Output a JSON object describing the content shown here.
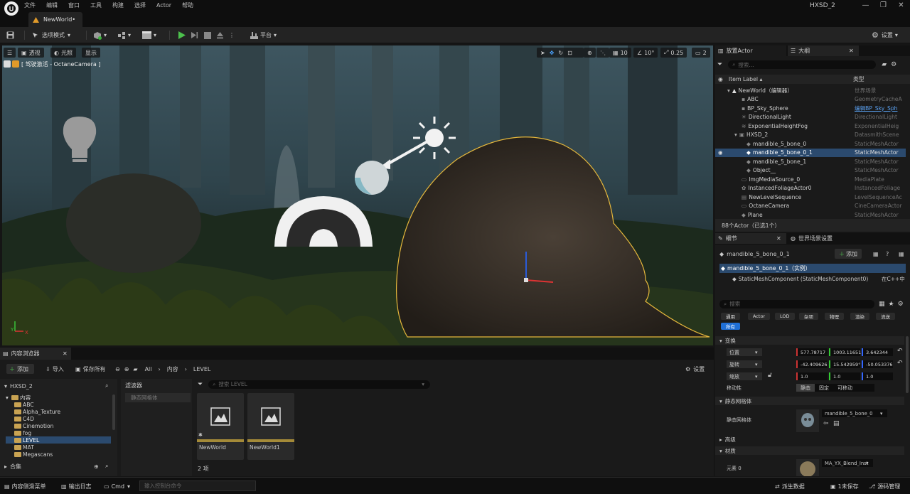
{
  "app": {
    "menu": [
      "文件",
      "编辑",
      "窗口",
      "工具",
      "构建",
      "选择",
      "Actor",
      "帮助"
    ],
    "doc_tab": "NewWorld•",
    "project": "HXSD_2"
  },
  "toolbar": {
    "mode": "选项模式",
    "platform": "平台",
    "settings": "设置"
  },
  "viewport": {
    "perspective": "透视",
    "lit": "光照",
    "show": "显示",
    "camera_label": "[ 驾驶激活 - OctaneCamera ]",
    "grid": "10",
    "angle": "10°",
    "scale": "0.25",
    "cams": "2",
    "axis_x": "X",
    "axis_y": "Y"
  },
  "outliner": {
    "tab_place": "放置Actor",
    "tab_outline": "大纲",
    "search_placeholder": "搜索...",
    "col_label": "Item Label ▴",
    "col_type": "类型",
    "rows": [
      {
        "label": "NewWorld（编辑器）",
        "type": "世界场景"
      },
      {
        "label": "ABC",
        "type": "GeometryCacheA"
      },
      {
        "label": "BP_Sky_Sphere",
        "type": "编辑BP_Sky_Sph"
      },
      {
        "label": "DirectionalLight",
        "type": "DirectionalLight"
      },
      {
        "label": "ExponentialHeightFog",
        "type": "ExponentialHeig"
      },
      {
        "label": "HXSD_2",
        "type": "DatasmithScene"
      },
      {
        "label": "mandible_5_bone_0",
        "type": "StaticMeshActor"
      },
      {
        "label": "mandible_5_bone_0_1",
        "type": "StaticMeshActor"
      },
      {
        "label": "mandible_5_bone_1",
        "type": "StaticMeshActor"
      },
      {
        "label": "Object__",
        "type": "StaticMeshActor"
      },
      {
        "label": "ImgMediaSource_0",
        "type": "MediaPlate"
      },
      {
        "label": "InstancedFoliageActor0",
        "type": "InstancedFoliage"
      },
      {
        "label": "NewLevelSequence",
        "type": "LevelSequenceAc"
      },
      {
        "label": "OctaneCamera",
        "type": "CineCameraActor"
      },
      {
        "label": "Plane",
        "type": "StaticMeshActor"
      }
    ],
    "count": "88个Actor（已选1个）"
  },
  "details": {
    "tab_details": "细节",
    "tab_world": "世界场景设置",
    "object_name": "mandible_5_bone_0_1",
    "add_button": "添加",
    "instance": "mandible_5_bone_0_1（实例）",
    "component": "StaticMeshComponent (StaticMeshComponent0)",
    "cpp_link": "在C++中",
    "search_placeholder": "搜索",
    "filters": [
      "通用",
      "Actor",
      "LOD",
      "杂项",
      "物理",
      "渲染",
      "流送"
    ],
    "filter_all": "所有",
    "section_transform": "变换",
    "location_label": "位置",
    "location": [
      "577.78717",
      "1003.11651",
      "3.642344"
    ],
    "rotation_label": "旋转",
    "rotation": [
      "-42.409626",
      "15.542959°",
      "-50.053376"
    ],
    "scale_label": "缩放",
    "scale": [
      "1.0",
      "1.0",
      "1.0"
    ],
    "mobility_label": "移动性",
    "mobility": [
      "静态",
      "固定",
      "可移动"
    ],
    "section_mesh": "静态网格体",
    "mesh_label": "静态网格体",
    "mesh_value": "mandible_5_bone_0",
    "section_advanced": "高级",
    "section_materials": "材质",
    "element_label": "元素 0",
    "material_value": "MA_YX_Blend_Inst"
  },
  "content": {
    "tab": "内容浏览器",
    "add": "添加",
    "import": "导入",
    "save_all": "保存所有",
    "crumbs": [
      "All",
      "内容",
      "LEVEL"
    ],
    "settings": "设置",
    "tree_root": "HXSD_2",
    "folders": [
      "内容",
      "ABC",
      "Alpha_Texture",
      "C4D",
      "Cinemotion",
      "fog",
      "LEVEL",
      "MAT",
      "Megascans"
    ],
    "filter_title": "滤波器",
    "filter_item": "静态网格体",
    "search_placeholder": "搜索 LEVEL",
    "assets": [
      "NewWorld",
      "NewWorld1"
    ],
    "count": "2 项",
    "collections": "合集"
  },
  "status": {
    "drawer": "内容侧滑菜单",
    "log": "输出日志",
    "cmd": "Cmd",
    "console_placeholder": "输入控制台命令",
    "derived": "派生数据",
    "unsaved": "1未保存",
    "source": "源码管理"
  }
}
